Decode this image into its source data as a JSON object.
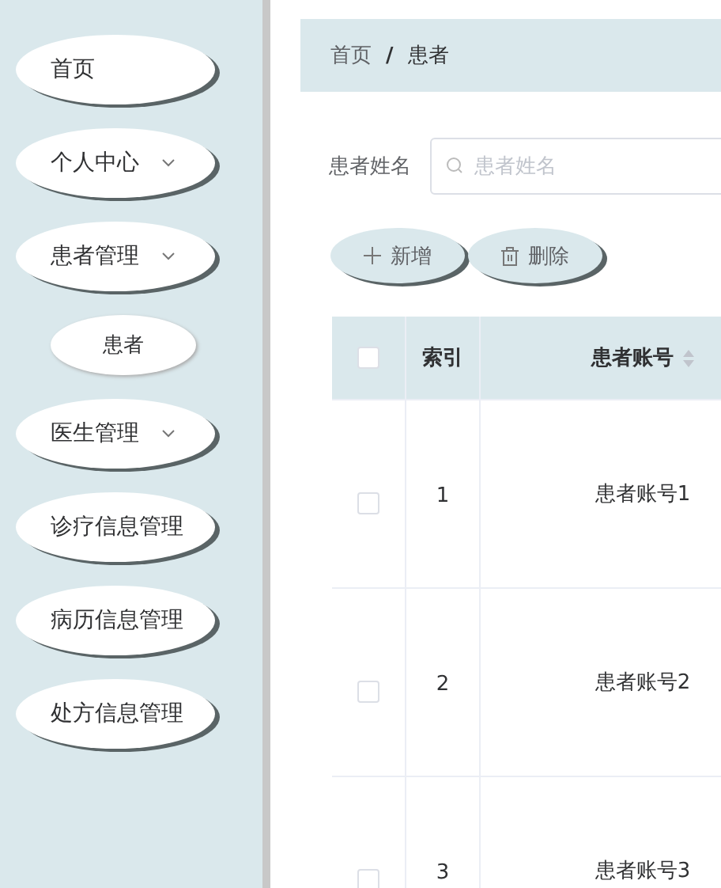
{
  "sidebar": {
    "items": [
      {
        "label": "首页",
        "kind": "link"
      },
      {
        "label": "个人中心",
        "kind": "submenu"
      },
      {
        "label": "患者管理",
        "kind": "submenu",
        "children": [
          {
            "label": "患者"
          }
        ]
      },
      {
        "label": "医生管理",
        "kind": "submenu"
      },
      {
        "label": "诊疗信息管理",
        "kind": "link"
      },
      {
        "label": "病历信息管理",
        "kind": "link"
      },
      {
        "label": "处方信息管理",
        "kind": "link"
      }
    ]
  },
  "breadcrumb": [
    "首页",
    "患者"
  ],
  "breadcrumb_separator": "/",
  "search": {
    "label": "患者姓名",
    "placeholder": "患者姓名"
  },
  "buttons": [
    {
      "label": "新增",
      "kind": "add"
    },
    {
      "label": "删除",
      "kind": "delete"
    }
  ],
  "table": {
    "header_checked": false,
    "columns": [
      {
        "label": "索引",
        "sortable": false
      },
      {
        "label": "患者账号",
        "sortable": true
      }
    ],
    "rows": [
      {
        "checked": false,
        "index": "1",
        "account": "患者账号1"
      },
      {
        "checked": false,
        "index": "2",
        "account": "患者账号2"
      },
      {
        "checked": false,
        "index": "3",
        "account": "患者账号3"
      }
    ]
  }
}
